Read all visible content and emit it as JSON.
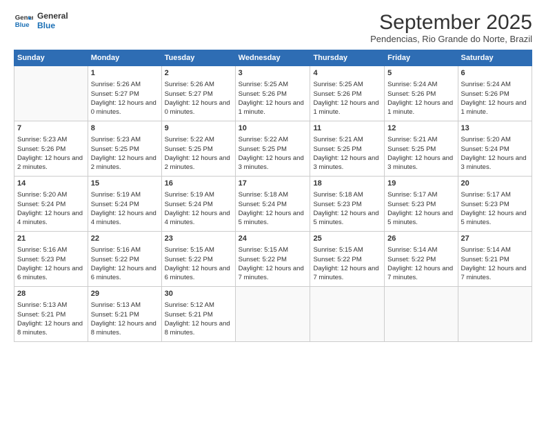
{
  "logo": {
    "line1": "General",
    "line2": "Blue"
  },
  "title": "September 2025",
  "subtitle": "Pendencias, Rio Grande do Norte, Brazil",
  "days_of_week": [
    "Sunday",
    "Monday",
    "Tuesday",
    "Wednesday",
    "Thursday",
    "Friday",
    "Saturday"
  ],
  "weeks": [
    [
      {
        "day": "",
        "sunrise": "",
        "sunset": "",
        "daylight": ""
      },
      {
        "day": "1",
        "sunrise": "Sunrise: 5:26 AM",
        "sunset": "Sunset: 5:27 PM",
        "daylight": "Daylight: 12 hours and 0 minutes."
      },
      {
        "day": "2",
        "sunrise": "Sunrise: 5:26 AM",
        "sunset": "Sunset: 5:27 PM",
        "daylight": "Daylight: 12 hours and 0 minutes."
      },
      {
        "day": "3",
        "sunrise": "Sunrise: 5:25 AM",
        "sunset": "Sunset: 5:26 PM",
        "daylight": "Daylight: 12 hours and 1 minute."
      },
      {
        "day": "4",
        "sunrise": "Sunrise: 5:25 AM",
        "sunset": "Sunset: 5:26 PM",
        "daylight": "Daylight: 12 hours and 1 minute."
      },
      {
        "day": "5",
        "sunrise": "Sunrise: 5:24 AM",
        "sunset": "Sunset: 5:26 PM",
        "daylight": "Daylight: 12 hours and 1 minute."
      },
      {
        "day": "6",
        "sunrise": "Sunrise: 5:24 AM",
        "sunset": "Sunset: 5:26 PM",
        "daylight": "Daylight: 12 hours and 1 minute."
      }
    ],
    [
      {
        "day": "7",
        "sunrise": "Sunrise: 5:23 AM",
        "sunset": "Sunset: 5:26 PM",
        "daylight": "Daylight: 12 hours and 2 minutes."
      },
      {
        "day": "8",
        "sunrise": "Sunrise: 5:23 AM",
        "sunset": "Sunset: 5:25 PM",
        "daylight": "Daylight: 12 hours and 2 minutes."
      },
      {
        "day": "9",
        "sunrise": "Sunrise: 5:22 AM",
        "sunset": "Sunset: 5:25 PM",
        "daylight": "Daylight: 12 hours and 2 minutes."
      },
      {
        "day": "10",
        "sunrise": "Sunrise: 5:22 AM",
        "sunset": "Sunset: 5:25 PM",
        "daylight": "Daylight: 12 hours and 3 minutes."
      },
      {
        "day": "11",
        "sunrise": "Sunrise: 5:21 AM",
        "sunset": "Sunset: 5:25 PM",
        "daylight": "Daylight: 12 hours and 3 minutes."
      },
      {
        "day": "12",
        "sunrise": "Sunrise: 5:21 AM",
        "sunset": "Sunset: 5:25 PM",
        "daylight": "Daylight: 12 hours and 3 minutes."
      },
      {
        "day": "13",
        "sunrise": "Sunrise: 5:20 AM",
        "sunset": "Sunset: 5:24 PM",
        "daylight": "Daylight: 12 hours and 3 minutes."
      }
    ],
    [
      {
        "day": "14",
        "sunrise": "Sunrise: 5:20 AM",
        "sunset": "Sunset: 5:24 PM",
        "daylight": "Daylight: 12 hours and 4 minutes."
      },
      {
        "day": "15",
        "sunrise": "Sunrise: 5:19 AM",
        "sunset": "Sunset: 5:24 PM",
        "daylight": "Daylight: 12 hours and 4 minutes."
      },
      {
        "day": "16",
        "sunrise": "Sunrise: 5:19 AM",
        "sunset": "Sunset: 5:24 PM",
        "daylight": "Daylight: 12 hours and 4 minutes."
      },
      {
        "day": "17",
        "sunrise": "Sunrise: 5:18 AM",
        "sunset": "Sunset: 5:24 PM",
        "daylight": "Daylight: 12 hours and 5 minutes."
      },
      {
        "day": "18",
        "sunrise": "Sunrise: 5:18 AM",
        "sunset": "Sunset: 5:23 PM",
        "daylight": "Daylight: 12 hours and 5 minutes."
      },
      {
        "day": "19",
        "sunrise": "Sunrise: 5:17 AM",
        "sunset": "Sunset: 5:23 PM",
        "daylight": "Daylight: 12 hours and 5 minutes."
      },
      {
        "day": "20",
        "sunrise": "Sunrise: 5:17 AM",
        "sunset": "Sunset: 5:23 PM",
        "daylight": "Daylight: 12 hours and 5 minutes."
      }
    ],
    [
      {
        "day": "21",
        "sunrise": "Sunrise: 5:16 AM",
        "sunset": "Sunset: 5:23 PM",
        "daylight": "Daylight: 12 hours and 6 minutes."
      },
      {
        "day": "22",
        "sunrise": "Sunrise: 5:16 AM",
        "sunset": "Sunset: 5:22 PM",
        "daylight": "Daylight: 12 hours and 6 minutes."
      },
      {
        "day": "23",
        "sunrise": "Sunrise: 5:15 AM",
        "sunset": "Sunset: 5:22 PM",
        "daylight": "Daylight: 12 hours and 6 minutes."
      },
      {
        "day": "24",
        "sunrise": "Sunrise: 5:15 AM",
        "sunset": "Sunset: 5:22 PM",
        "daylight": "Daylight: 12 hours and 7 minutes."
      },
      {
        "day": "25",
        "sunrise": "Sunrise: 5:15 AM",
        "sunset": "Sunset: 5:22 PM",
        "daylight": "Daylight: 12 hours and 7 minutes."
      },
      {
        "day": "26",
        "sunrise": "Sunrise: 5:14 AM",
        "sunset": "Sunset: 5:22 PM",
        "daylight": "Daylight: 12 hours and 7 minutes."
      },
      {
        "day": "27",
        "sunrise": "Sunrise: 5:14 AM",
        "sunset": "Sunset: 5:21 PM",
        "daylight": "Daylight: 12 hours and 7 minutes."
      }
    ],
    [
      {
        "day": "28",
        "sunrise": "Sunrise: 5:13 AM",
        "sunset": "Sunset: 5:21 PM",
        "daylight": "Daylight: 12 hours and 8 minutes."
      },
      {
        "day": "29",
        "sunrise": "Sunrise: 5:13 AM",
        "sunset": "Sunset: 5:21 PM",
        "daylight": "Daylight: 12 hours and 8 minutes."
      },
      {
        "day": "30",
        "sunrise": "Sunrise: 5:12 AM",
        "sunset": "Sunset: 5:21 PM",
        "daylight": "Daylight: 12 hours and 8 minutes."
      },
      {
        "day": "",
        "sunrise": "",
        "sunset": "",
        "daylight": ""
      },
      {
        "day": "",
        "sunrise": "",
        "sunset": "",
        "daylight": ""
      },
      {
        "day": "",
        "sunrise": "",
        "sunset": "",
        "daylight": ""
      },
      {
        "day": "",
        "sunrise": "",
        "sunset": "",
        "daylight": ""
      }
    ]
  ]
}
